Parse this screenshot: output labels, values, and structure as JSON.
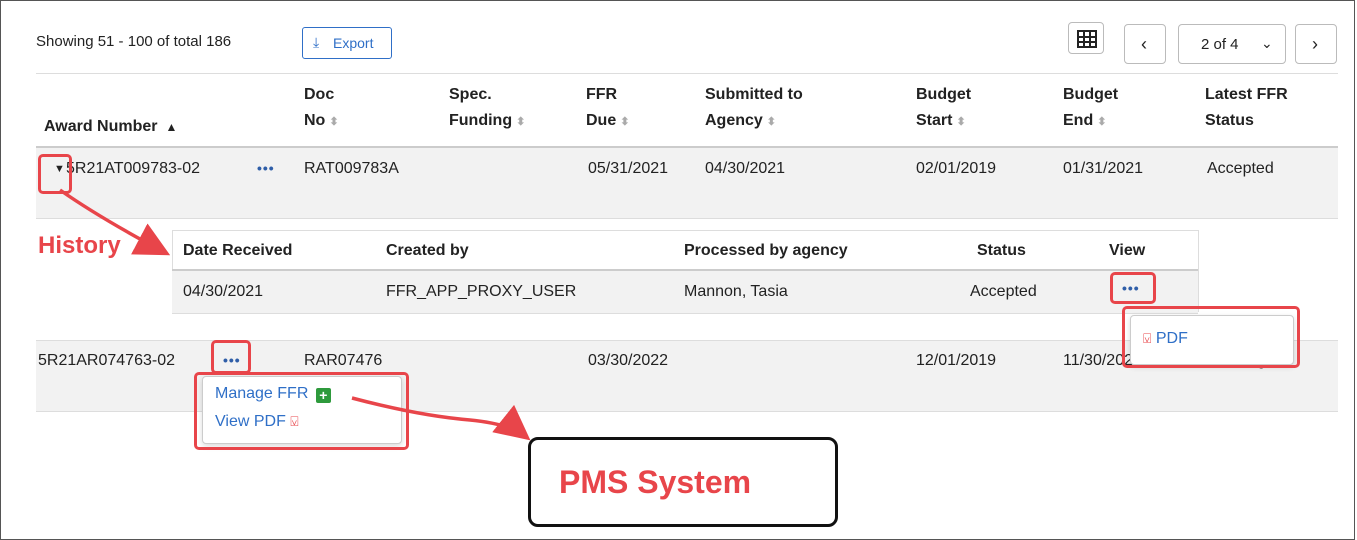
{
  "toolbar": {
    "showing": "Showing 51 - 100 of total 186",
    "export_label": "Export",
    "page_select": "2 of 4",
    "prev": "‹",
    "next": "›"
  },
  "columns": {
    "award_number": "Award Number",
    "doc_no_1": "Doc",
    "doc_no_2": "No",
    "spec_funding_1": "Spec.",
    "spec_funding_2": "Funding",
    "ffr_due_1": "FFR",
    "ffr_due_2": "Due",
    "submitted_1": "Submitted to",
    "submitted_2": "Agency",
    "budget_start_1": "Budget",
    "budget_start_2": "Start",
    "budget_end_1": "Budget",
    "budget_end_2": "End",
    "latest_1": "Latest FFR",
    "latest_2": "Status"
  },
  "rows": [
    {
      "award": "5R21AT009783-02",
      "doc_no": "RAT009783A",
      "ffr_due": "05/31/2021",
      "submitted": "04/30/2021",
      "budget_start": "02/01/2019",
      "budget_end": "01/31/2021",
      "status": "Accepted"
    },
    {
      "award": "5R21AR074763-02",
      "doc_no": "RAR07476",
      "ffr_due": "03/30/2022",
      "budget_start": "12/01/2019",
      "budget_end": "11/30/2021",
      "status": "Pending"
    }
  ],
  "history": {
    "columns": [
      "Date Received",
      "Created by",
      "Processed by agency",
      "Status",
      "View"
    ],
    "row": {
      "date": "04/30/2021",
      "created_by": "FFR_APP_PROXY_USER",
      "processed_by": "Mannon, Tasia",
      "status": "Accepted"
    }
  },
  "view_menu": {
    "pdf": "PDF"
  },
  "row_menu": {
    "manage_ffr": "Manage FFR",
    "view_pdf": "View PDF"
  },
  "annotations": {
    "history": "History",
    "pms": "PMS System"
  },
  "colors": {
    "accent": "#2f6fc7",
    "callout": "#e8454a",
    "row_bg": "#f2f2f2"
  }
}
